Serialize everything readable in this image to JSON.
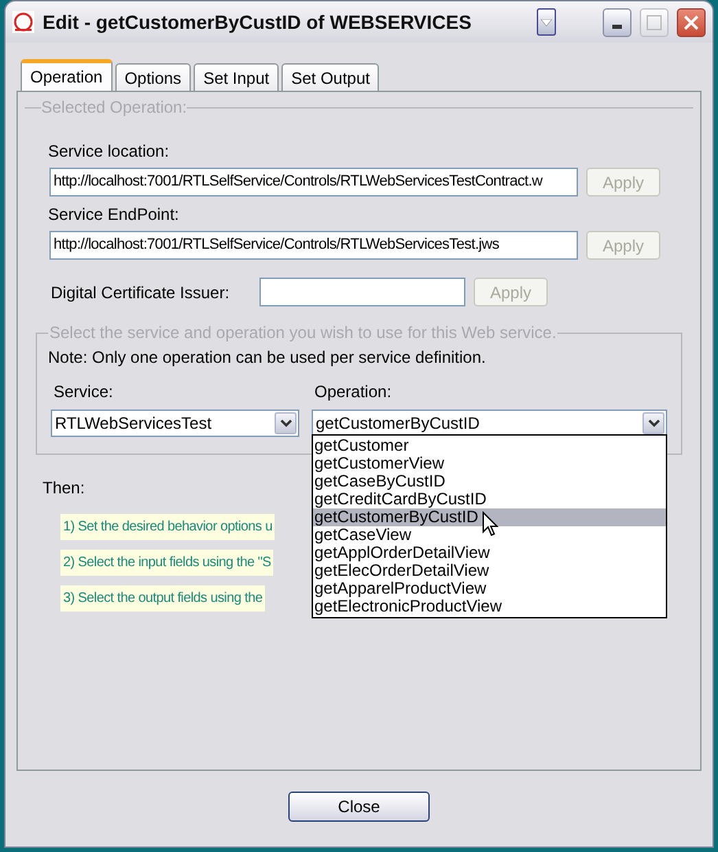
{
  "window": {
    "title": "Edit - getCustomerByCustID of WEBSERVICES"
  },
  "tabs": [
    {
      "label": "Operation",
      "selected": true
    },
    {
      "label": "Options",
      "selected": false
    },
    {
      "label": "Set Input",
      "selected": false
    },
    {
      "label": "Set Output",
      "selected": false
    }
  ],
  "selected_operation": {
    "legend": "Selected Operation:",
    "fields": [
      {
        "label": "Service location:",
        "value": "http://localhost:7001/RTLSelfService/Controls/RTLWebServicesTestContract.w",
        "button": "Apply",
        "disabled": true
      },
      {
        "label": "Service EndPoint:",
        "value": "http://localhost:7001/RTLSelfService/Controls/RTLWebServicesTest.jws",
        "button": "Apply",
        "disabled": true
      }
    ],
    "certificate": {
      "label": "Digital Certificate Issuer:",
      "button": "Apply",
      "disabled": true
    }
  },
  "service_group": {
    "legend": "Select the service and operation you wish to use for this Web service.",
    "note": "Note: Only one operation can be used per service definition.",
    "service": {
      "label": "Service:",
      "value": "RTLWebServicesTest"
    },
    "operation": {
      "label": "Operation:",
      "value": "getCustomerByCustID",
      "options": [
        {
          "label": "getCustomer",
          "selected": false
        },
        {
          "label": "getCustomerView",
          "selected": false
        },
        {
          "label": "getCaseByCustID",
          "selected": false
        },
        {
          "label": "getCreditCardByCustID",
          "selected": false
        },
        {
          "label": "getCustomerByCustID",
          "selected": true
        },
        {
          "label": "getCaseView",
          "selected": false
        },
        {
          "label": "getApplOrderDetailView",
          "selected": false
        },
        {
          "label": "getElecOrderDetailView",
          "selected": false
        },
        {
          "label": "getApparelProductView",
          "selected": false
        },
        {
          "label": "getElectronicProductView",
          "selected": false
        }
      ]
    }
  },
  "then": {
    "label": "Then:",
    "steps": [
      "1) Set the desired behavior options u",
      "2) Select the input fields using the \"S",
      "3) Select the output fields using the"
    ]
  },
  "buttons": [
    "Close"
  ]
}
